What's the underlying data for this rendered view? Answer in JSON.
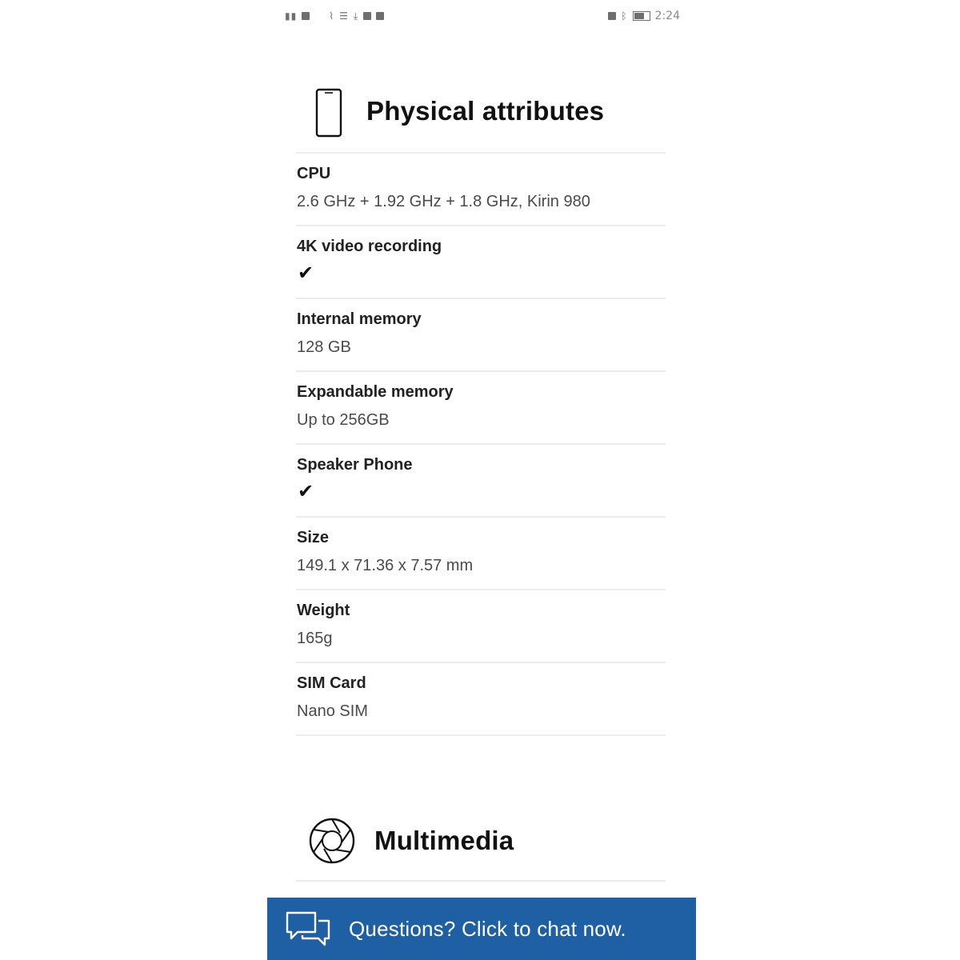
{
  "status_bar": {
    "left_icons": [
      "signal-icon",
      "sim-icon",
      "wifi-icon",
      "settings-icon",
      "download-icon",
      "image-icon",
      "mail-icon"
    ],
    "right_icons": [
      "nfc-icon",
      "bluetooth-icon",
      "battery-icon"
    ],
    "time": "2:24"
  },
  "physical_section": {
    "title": "Physical attributes",
    "icon": "smartphone-icon"
  },
  "specs": [
    {
      "label": "CPU",
      "value": "2.6 GHz + 1.92 GHz + 1.8 GHz, Kirin 980",
      "check": false
    },
    {
      "label": "4K video recording",
      "value": "",
      "check": true
    },
    {
      "label": "Internal memory",
      "value": "128 GB",
      "check": false
    },
    {
      "label": "Expandable memory",
      "value": "Up to 256GB",
      "check": false
    },
    {
      "label": "Speaker Phone",
      "value": "",
      "check": true
    },
    {
      "label": "Size",
      "value": "149.1 x 71.36 x 7.57 mm",
      "check": false
    },
    {
      "label": "Weight",
      "value": "165g",
      "check": false
    },
    {
      "label": "SIM Card",
      "value": "Nano SIM",
      "check": false
    }
  ],
  "check_glyph": "✔",
  "multimedia_section": {
    "title": "Multimedia",
    "icon": "aperture-icon"
  },
  "chat_banner": {
    "text": "Questions? Click to chat now.",
    "icon": "chat-bubbles-icon",
    "background": "#1f5fa3"
  }
}
